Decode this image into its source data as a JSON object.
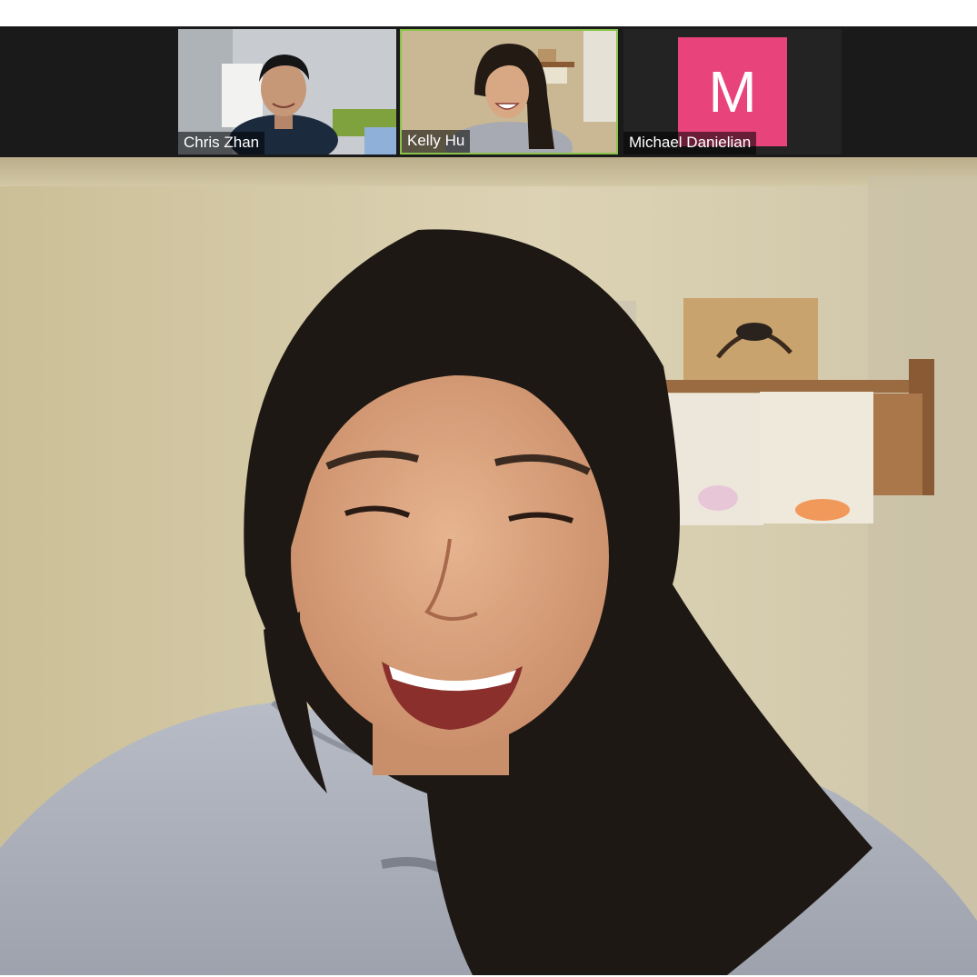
{
  "participants": [
    {
      "name": "Chris Zhan",
      "video": true
    },
    {
      "name": "Kelly Hu",
      "video": true,
      "active_speaker": true
    },
    {
      "name": "Michael Danielian",
      "video": false,
      "avatar_letter": "M",
      "avatar_color": "#e8437a"
    }
  ],
  "colors": {
    "strip_background": "#1a1a1a",
    "active_speaker_border": "#8bc34a",
    "wall": "#d8cfae"
  }
}
